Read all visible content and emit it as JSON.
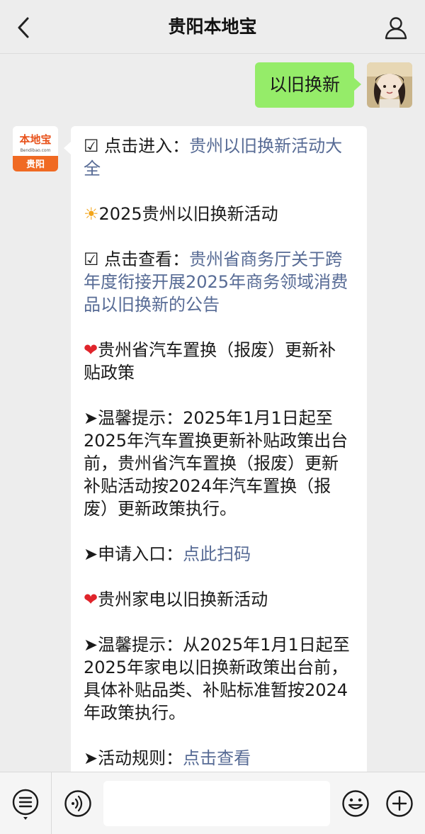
{
  "header": {
    "title": "贵阳本地宝"
  },
  "outgoing": {
    "text": "以旧换新"
  },
  "bot": {
    "logo_text": "本地宝",
    "logo_sub": "Bendibao.com",
    "logo_city": "贵阳"
  },
  "message": {
    "p1_prefix": "☑ 点击进入：",
    "p1_link": "贵州以旧换新活动大全",
    "p2_icon": "☀",
    "p2_text": "2025贵州以旧换新活动",
    "p3_prefix": "☑ 点击查看：",
    "p3_link": "贵州省商务厅关于跨年度衔接开展2025年商务领域消费品以旧换新的公告",
    "p4_icon": "❤",
    "p4_text": "贵州省汽车置换（报废）更新补贴政策",
    "p5_text": "➤温馨提示：2025年1月1日起至2025年汽车置换更新补贴政策出台前，贵州省汽车置换（报废）更新补贴活动按2024年汽车置换（报废）更新政策执行。",
    "p6_prefix": "➤申请入口：",
    "p6_link": "点此扫码",
    "p7_icon": "❤",
    "p7_text": "贵州家电以旧换新活动",
    "p8_text": "➤温馨提示：从2025年1月1日起至2025年家电以旧换新政策出台前，具体补贴品类、补贴标准暂按2024年政策执行。",
    "p9_prefix": "➤活动规则：",
    "p9_link": "点击查看"
  },
  "colors": {
    "link": "#576b95",
    "out_bubble": "#95ec69",
    "heart": "#e0242b",
    "logo_orange": "#f06a23"
  },
  "icons": [
    "back-icon",
    "profile-icon",
    "menu-icon",
    "voice-icon",
    "emoji-icon",
    "plus-icon"
  ]
}
